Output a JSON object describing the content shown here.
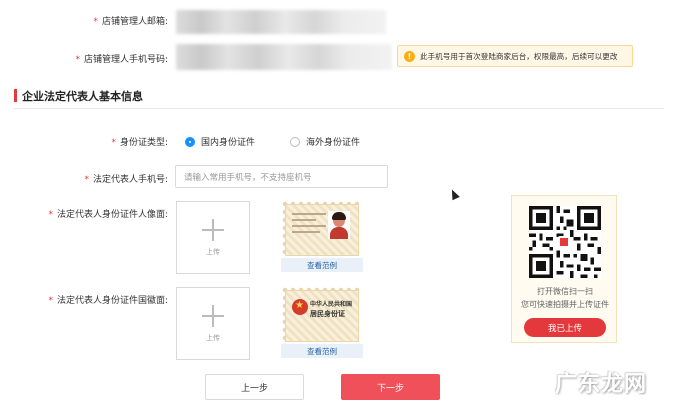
{
  "account": {
    "email_label": "店铺管理人邮箱:",
    "phone_label": "店铺管理人手机号码:",
    "phone_tip": "此手机号用于首次登陆商家后台，权限最高，后续可以更改",
    "tip_icon": "warning-icon"
  },
  "section": {
    "title": "企业法定代表人基本信息"
  },
  "form": {
    "id_type_label": "身份证类型:",
    "id_options": [
      {
        "label": "国内身份证件",
        "selected": true
      },
      {
        "label": "海外身份证件",
        "selected": false
      }
    ],
    "phone_label": "法定代表人手机号:",
    "phone_placeholder": "请输入常用手机号，不支持座机号",
    "front_label": "法定代表人身份证件人像面:",
    "back_label": "法定代表人身份证件国徽面:",
    "upload_text": "上传",
    "sample_text": "查看范例",
    "back_card_line1": "中华人民共和国",
    "back_card_line2": "居民身份证"
  },
  "qr": {
    "line1": "打开微信扫一扫",
    "line2": "您可快速拍摄并上传证件",
    "button": "我已上传"
  },
  "nav": {
    "prev": "上一步",
    "next": "下一步"
  },
  "watermark": "广东龙网",
  "colors": {
    "accent": "#e4393c",
    "primary_blue": "#1890ff",
    "tip_bg": "#fff7e6",
    "warning": "#faad14"
  }
}
